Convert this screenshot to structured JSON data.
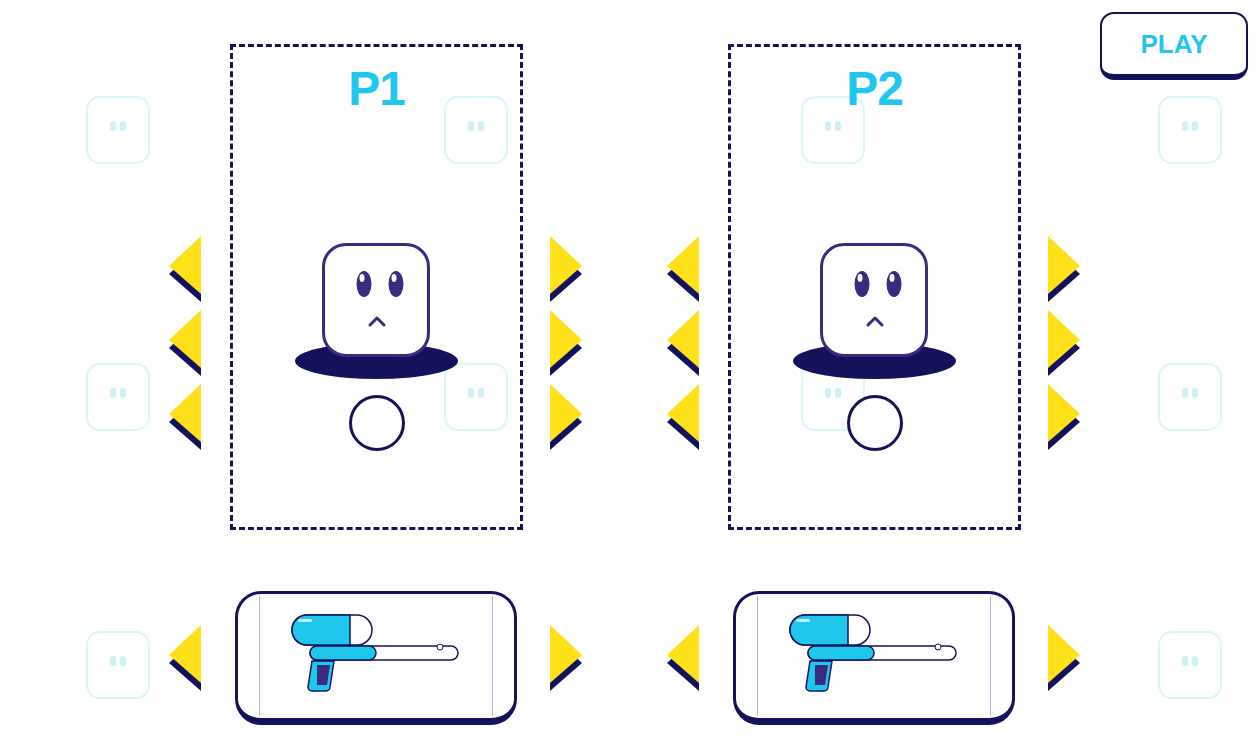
{
  "play_button": {
    "label": "PLAY"
  },
  "players": [
    {
      "label": "P1"
    },
    {
      "label": "P2"
    }
  ]
}
